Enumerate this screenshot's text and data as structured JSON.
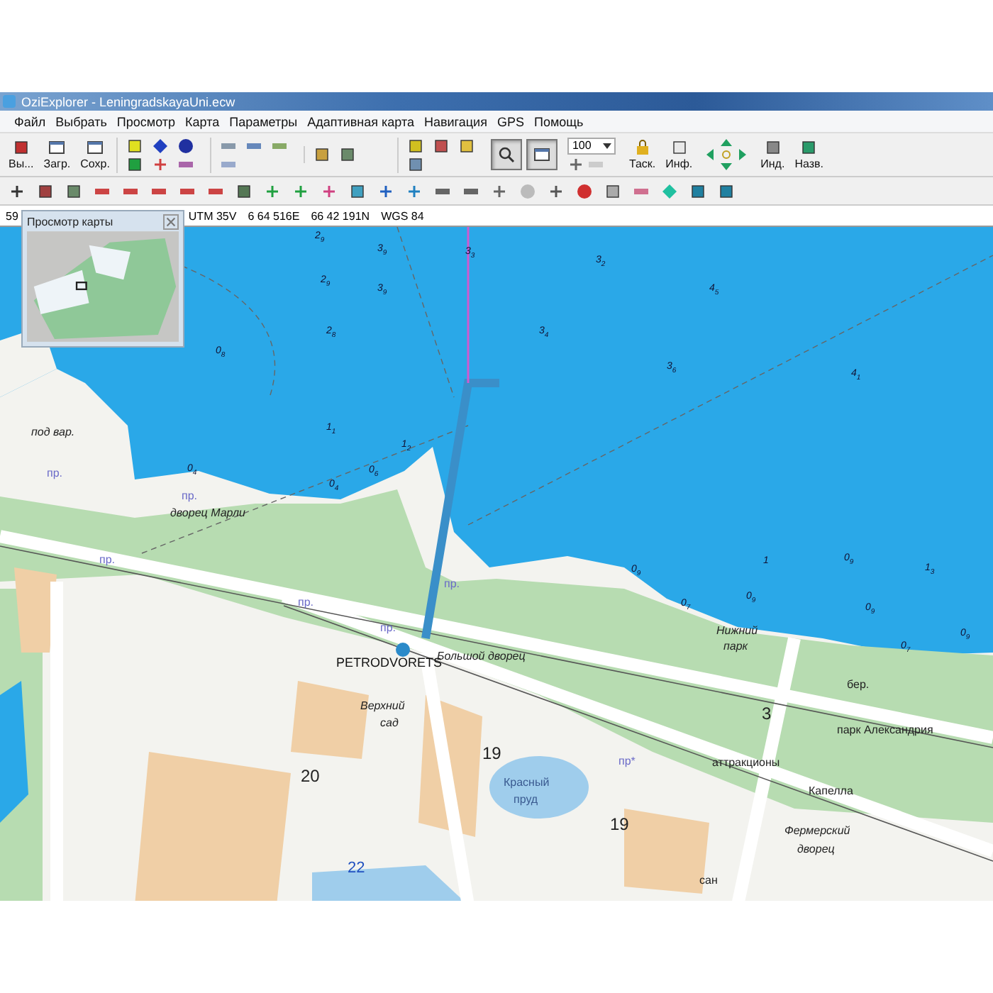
{
  "window": {
    "title": "OziExplorer - LeningradskayaUni.ecw"
  },
  "menu": [
    {
      "label": "Файл"
    },
    {
      "label": "Выбрать"
    },
    {
      "label": "Просмотр"
    },
    {
      "label": "Карта"
    },
    {
      "label": "Параметры"
    },
    {
      "label": "Адаптивная карта"
    },
    {
      "label": "Навигация"
    },
    {
      "label": "GPS"
    },
    {
      "label": "Помощь"
    }
  ],
  "toolbar": [
    {
      "kind": "labeled",
      "label": "Вы..."
    },
    {
      "kind": "labeled",
      "label": "Загр."
    },
    {
      "kind": "labeled",
      "label": "Сохр."
    },
    {
      "kind": "group"
    },
    {
      "kind": "group"
    },
    {
      "kind": "group"
    },
    {
      "kind": "group"
    },
    {
      "kind": "toggle",
      "pressed": true
    },
    {
      "kind": "toggle",
      "pressed": true
    },
    {
      "kind": "zoom",
      "value": "100"
    },
    {
      "kind": "labeled",
      "label": "Таск."
    },
    {
      "kind": "labeled",
      "label": "Инф."
    },
    {
      "kind": "pad"
    },
    {
      "kind": "labeled",
      "label": "Инд."
    },
    {
      "kind": "labeled",
      "label": "Назв."
    }
  ],
  "status_bar": {
    "field_1": "59",
    "zone": "UTM 35V",
    "easting": "6 64 516E",
    "northing": "66 42 191N",
    "datum": "WGS 84"
  },
  "overview_window": {
    "title": "Просмотр карты"
  },
  "map": {
    "labels": [
      {
        "text": "под вар.",
        "kind": "italic"
      },
      {
        "text": "пр.",
        "kind": "park"
      },
      {
        "text": "пр.",
        "kind": "park"
      },
      {
        "text": "дворец Марли",
        "kind": "italic"
      },
      {
        "text": "пр.",
        "kind": "park"
      },
      {
        "text": "пр.",
        "kind": "park"
      },
      {
        "text": "пр.",
        "kind": "park"
      },
      {
        "text": "PETRODVORETS",
        "kind": "city"
      },
      {
        "text": "Большой дворец",
        "kind": "italic"
      },
      {
        "text": "пр.",
        "kind": "park"
      },
      {
        "text": "Нижний",
        "kind": "italic"
      },
      {
        "text": "парк",
        "kind": "italic"
      },
      {
        "text": "3",
        "kind": "number"
      },
      {
        "text": "бер.",
        "kind": "plain"
      },
      {
        "text": "парк Александрия",
        "kind": "plain"
      },
      {
        "text": "Верхний",
        "kind": "italic"
      },
      {
        "text": "сад",
        "kind": "italic"
      },
      {
        "text": "19",
        "kind": "number"
      },
      {
        "text": "пр*",
        "kind": "park"
      },
      {
        "text": "аттракционы",
        "kind": "plain"
      },
      {
        "text": "20",
        "kind": "number"
      },
      {
        "text": "Красный",
        "kind": "water"
      },
      {
        "text": "пруд",
        "kind": "water"
      },
      {
        "text": "19",
        "kind": "number"
      },
      {
        "text": "Капелла",
        "kind": "plain"
      },
      {
        "text": "Фермерский",
        "kind": "italic"
      },
      {
        "text": "дворец",
        "kind": "italic"
      },
      {
        "text": "22",
        "kind": "waternum"
      },
      {
        "text": "сан",
        "kind": "plain"
      }
    ],
    "soundings": [
      "2$_{9}$",
      "3$_{9}$",
      "3$_{3}$",
      "2$_{9}$",
      "3$_{9}$",
      "2$_{8}$",
      "0$_{8}$",
      "3$_{4}$",
      "3$_{2}$",
      "4$_{1}$",
      "3$_{6}$",
      "4$_{5}$",
      "1$_{1}$",
      "1$_{2}$",
      "0$_{4}$",
      "0$_{6}$",
      "0$_{4}$",
      "0$_{9}$",
      "1",
      "0$_{9}$",
      "1$_{3}$",
      "0$_{7}$",
      "0$_{9}$",
      "0$_{9}$",
      "0$_{7}$",
      "0$_{9}$"
    ]
  }
}
